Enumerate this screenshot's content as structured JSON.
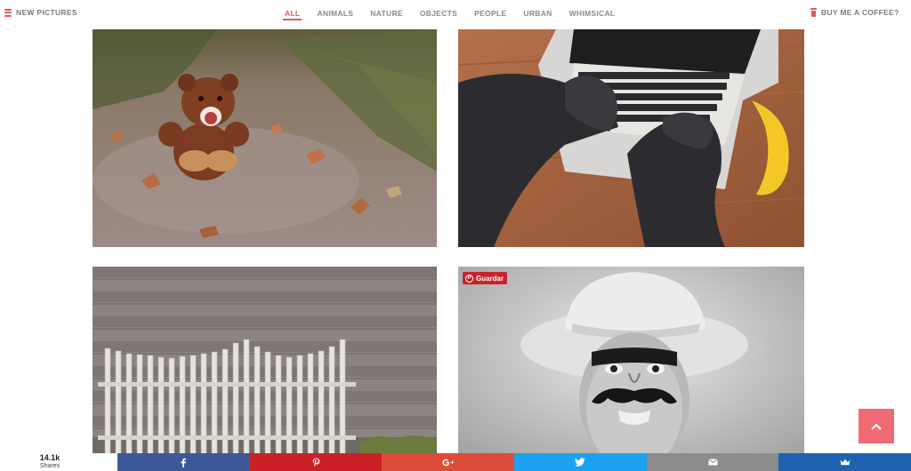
{
  "header": {
    "new_pictures": "NEW PICTURES",
    "coffee": "BUY ME A COFFEE?",
    "tabs": [
      "ALL",
      "ANIMALS",
      "NATURE",
      "OBJECTS",
      "PEOPLE",
      "URBAN",
      "WHIMSICAL"
    ],
    "active_tab": "ALL"
  },
  "photos": [
    {
      "subject": "teddy-bear-with-fangs"
    },
    {
      "subject": "gorilla-hands-typing-on-laptop"
    },
    {
      "subject": "wooden-fence"
    },
    {
      "subject": "cowboy-with-mustache"
    }
  ],
  "pin": {
    "label": "Guardar"
  },
  "share": {
    "count": "14.1k",
    "count_label": "Shares",
    "buttons": [
      {
        "network": "facebook",
        "icon": "facebook-icon",
        "color": "#3b5998"
      },
      {
        "network": "pinterest",
        "icon": "pinterest-icon",
        "color": "#cb2027"
      },
      {
        "network": "google-plus",
        "icon": "google-plus-icon",
        "color": "#dd4b39"
      },
      {
        "network": "twitter",
        "icon": "twitter-icon",
        "color": "#1da1f2"
      },
      {
        "network": "email",
        "icon": "email-icon",
        "color": "#8c8c8c"
      },
      {
        "network": "sumome",
        "icon": "crown-icon",
        "color": "#1f63b0"
      }
    ]
  },
  "colors": {
    "accent": "#e8565e",
    "to_top": "#ee6b73"
  }
}
